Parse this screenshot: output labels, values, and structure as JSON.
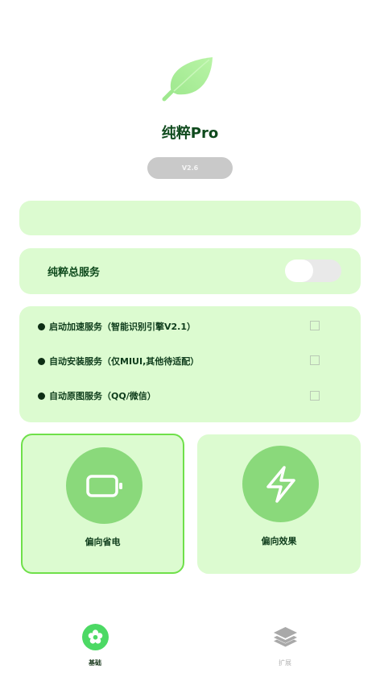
{
  "app": {
    "title": "纯粹Pro",
    "version": "V2.6",
    "logo_icon": "leaf-icon"
  },
  "service": {
    "label": "纯粹总服务",
    "toggle_on": false
  },
  "options": [
    {
      "label": "启动加速服务（智能识别引擎V2.1）",
      "checked": false
    },
    {
      "label": "自动安装服务（仅MIUI,其他待适配）",
      "checked": false
    },
    {
      "label": "自动原图服务（QQ/微信）",
      "checked": false
    }
  ],
  "modes": [
    {
      "label": "偏向省电",
      "icon": "battery-icon",
      "selected": true
    },
    {
      "label": "偏向效果",
      "icon": "lightning-icon",
      "selected": false
    }
  ],
  "nav": [
    {
      "label": "基础",
      "icon": "flower-icon",
      "active": true
    },
    {
      "label": "扩展",
      "icon": "layers-icon",
      "active": false
    }
  ],
  "colors": {
    "card_bg": "#dcfbd0",
    "accent_green": "#6fe04a",
    "icon_circle": "#8ad97b",
    "title_green": "#0f4a1d"
  }
}
